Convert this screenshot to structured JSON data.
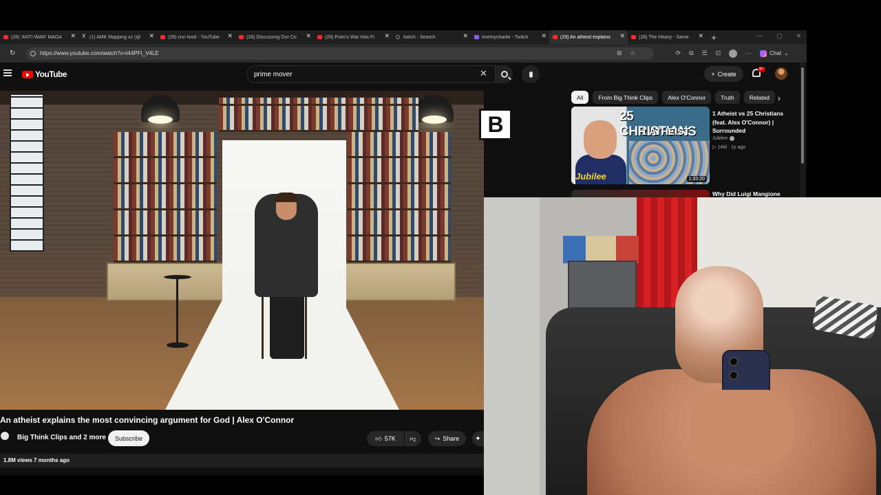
{
  "browser": {
    "tabs": [
      {
        "label": "(26) 'ANTI-WAR' MAGA",
        "favicon": "youtube-icon",
        "active": false
      },
      {
        "label": "(1) AMK Mapping xz (@",
        "favicon": "x-icon",
        "active": false
      },
      {
        "label": "(26) cnn food - YouTube",
        "favicon": "youtube-icon",
        "active": false
      },
      {
        "label": "(26) Discussing Our Co",
        "favicon": "youtube-icon",
        "active": false
      },
      {
        "label": "(26) Putin's War Has Fi",
        "favicon": "youtube-icon",
        "active": false
      },
      {
        "label": "twitch - Search",
        "favicon": "bing-icon",
        "active": false
      },
      {
        "label": "enemycharlie - Twitch",
        "favicon": "twitch-icon",
        "active": false
      },
      {
        "label": "(29) An atheist explains",
        "favicon": "youtube-icon",
        "active": true
      },
      {
        "label": "(28) The Heavy - Same",
        "favicon": "youtube-icon",
        "active": false
      }
    ],
    "new_tab": "+",
    "close_glyph": "✕",
    "url": "https://www.youtube.com/watch?v=t44PFI_V4LE",
    "chat_label": "Chat"
  },
  "youtube": {
    "logo_text": "YouTube",
    "search_value": "prime mover",
    "create_label": "Create",
    "notification_badge": "9+",
    "video": {
      "title": "An atheist explains the most convincing argument for God | Alex O'Connor",
      "channel": "Big Think Clips and 2 more",
      "subscribe_label": "Subscribe",
      "likes": "57K",
      "share_label": "Share",
      "views_line": "1.8M views  7 months ago",
      "watermark": "B"
    },
    "chips": [
      {
        "label": "All",
        "selected": true
      },
      {
        "label": "From Big Think Clips",
        "selected": false
      },
      {
        "label": "Alex O'Connor",
        "selected": false
      },
      {
        "label": "Truth",
        "selected": false
      },
      {
        "label": "Related",
        "selected": false
      }
    ],
    "recommendations": [
      {
        "thumb_line1": "25 CHRISTIANS",
        "thumb_line2": "1 ATHEIST",
        "thumb_brand": "Jubilee",
        "duration": "1:33:20",
        "title": "1 Atheist vs 25 Christians (feat. Alex O'Connor) | Surrounded",
        "channel": "Jubilee",
        "meta": "14M · 1y ago"
      },
      {
        "title": "Why Did Luigi Mangione"
      }
    ]
  },
  "colors": {
    "yt_red": "#ff0000",
    "background": "#0f0f0f",
    "chip_selected": "#f1f1f1"
  }
}
